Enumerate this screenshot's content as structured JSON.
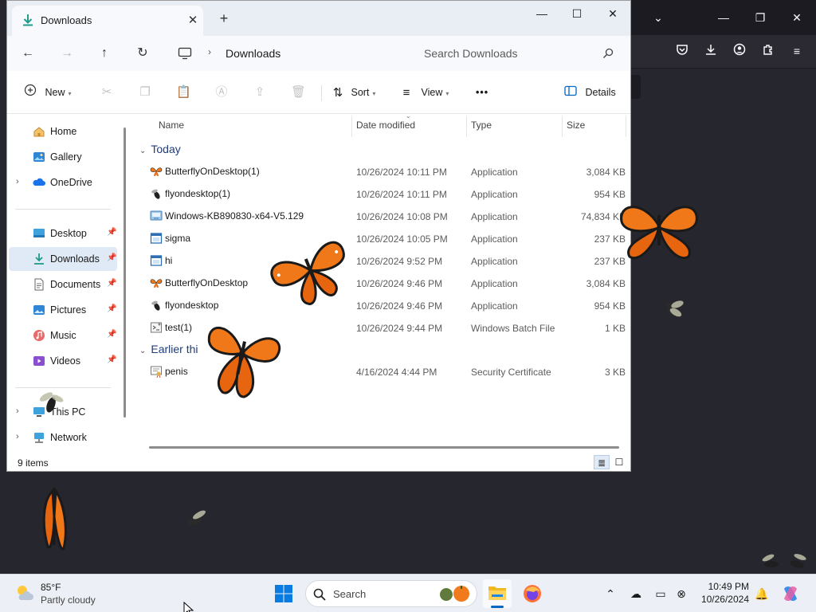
{
  "colors": {
    "desktop": "#26262e",
    "accent": "#0067c0",
    "selection": "#e0e9f6",
    "group_header": "#1f3d7a",
    "butterfly_orange": "#f07818"
  },
  "explorer": {
    "tab_title": "Downloads",
    "tab_close": "✕",
    "new_tab": "+",
    "window_controls": {
      "minimize": "—",
      "maximize": "☐",
      "close": "✕"
    },
    "nav": {
      "back": "←",
      "forward": "→",
      "up": "↑",
      "refresh": "↻"
    },
    "address": {
      "separator": "›",
      "location": "Downloads"
    },
    "search": {
      "placeholder": "Search Downloads"
    },
    "commands": {
      "new": "New",
      "sort": "Sort",
      "view": "View",
      "more": "•••",
      "details": "Details"
    },
    "sidebar": {
      "home": "Home",
      "gallery": "Gallery",
      "onedrive": "OneDrive",
      "desktop": "Desktop",
      "downloads": "Downloads",
      "documents": "Documents",
      "pictures": "Pictures",
      "music": "Music",
      "videos": "Videos",
      "this_pc": "This PC",
      "network": "Network"
    },
    "columns": {
      "name": "Name",
      "date": "Date modified",
      "type": "Type",
      "size": "Size"
    },
    "groups": {
      "today": "Today",
      "earlier": "Earlier thi"
    },
    "files": [
      {
        "name": "ButterflyOnDesktop(1)",
        "date": "10/26/2024 10:11 PM",
        "type": "Application",
        "size": "3,084 KB",
        "icon": "butterfly-app-icon"
      },
      {
        "name": "flyondesktop(1)",
        "date": "10/26/2024 10:11 PM",
        "type": "Application",
        "size": "954 KB",
        "icon": "fly-app-icon"
      },
      {
        "name": "Windows-KB890830-x64-V5.129",
        "date": "10/26/2024 10:08 PM",
        "type": "Application",
        "size": "74,834 KB",
        "icon": "installer-icon"
      },
      {
        "name": "sigma",
        "date": "10/26/2024 10:05 PM",
        "type": "Application",
        "size": "237 KB",
        "icon": "app-window-icon"
      },
      {
        "name": "hi",
        "date": "10/26/2024 9:52 PM",
        "type": "Application",
        "size": "237 KB",
        "icon": "app-window-icon"
      },
      {
        "name": "ButterflyOnDesktop",
        "date": "10/26/2024 9:46 PM",
        "type": "Application",
        "size": "3,084 KB",
        "icon": "butterfly-app-icon"
      },
      {
        "name": "flyondesktop",
        "date": "10/26/2024 9:46 PM",
        "type": "Application",
        "size": "954 KB",
        "icon": "fly-app-icon"
      },
      {
        "name": "test(1)",
        "date": "10/26/2024 9:44 PM",
        "type": "Windows Batch File",
        "size": "1 KB",
        "icon": "batch-file-icon"
      }
    ],
    "earlier_files": [
      {
        "name": "penis",
        "date": "4/16/2024 4:44 PM",
        "type": "Security Certificate",
        "size": "3 KB",
        "icon": "certificate-icon"
      }
    ],
    "status": "9 items"
  },
  "taskbar": {
    "weather_temp": "85°F",
    "weather_desc": "Partly cloudy",
    "search_label": "Search",
    "time": "10:49 PM",
    "date": "10/26/2024"
  }
}
